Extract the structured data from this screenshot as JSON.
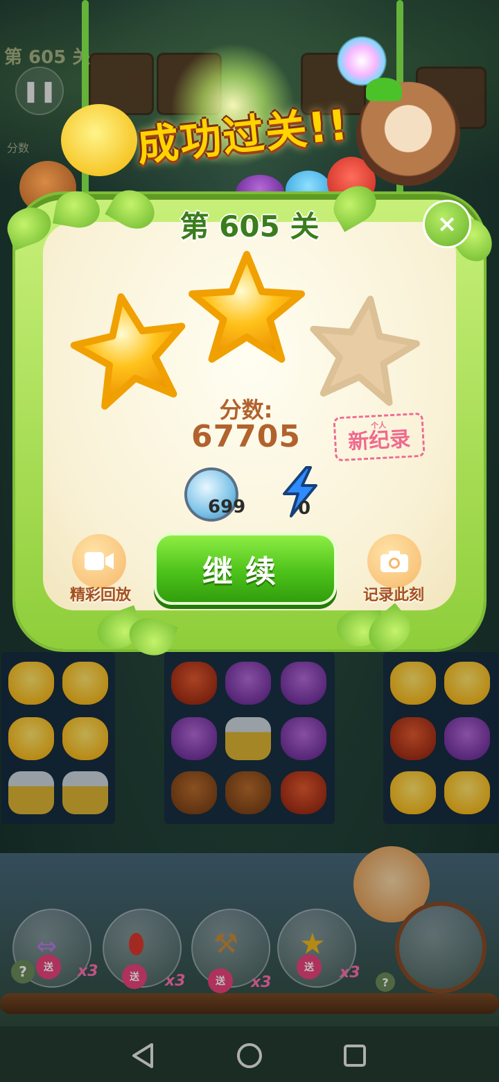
{
  "hud": {
    "level": "第 605 关",
    "score_label": "分数"
  },
  "banner": {
    "title": "成功过关!!"
  },
  "dialog": {
    "level_title": "第 605 关",
    "close_symbol": "×",
    "stars_earned": 2,
    "stars_total": 3,
    "score_label": "分数:",
    "score_value": "67705",
    "record_badge_sub": "个人",
    "record_badge": "新纪录",
    "coins": "699",
    "energy": "0",
    "replay_label": "精彩回放",
    "continue_label": "继续",
    "snapshot_label": "记录此刻"
  },
  "boosters": [
    {
      "icon": "swap-icon",
      "badge": "送",
      "count": "x3"
    },
    {
      "icon": "rocket-icon",
      "badge": "送",
      "count": "x3"
    },
    {
      "icon": "hammer-icon",
      "badge": "送",
      "count": "x3"
    },
    {
      "icon": "star-wand-icon",
      "badge": "送",
      "count": "x3"
    }
  ],
  "help_symbol": "?",
  "colors": {
    "accent_green": "#4cc21a",
    "score_brown": "#b1622d",
    "record_pink": "#ef6a8f",
    "star_gold": "#ffc21a"
  }
}
